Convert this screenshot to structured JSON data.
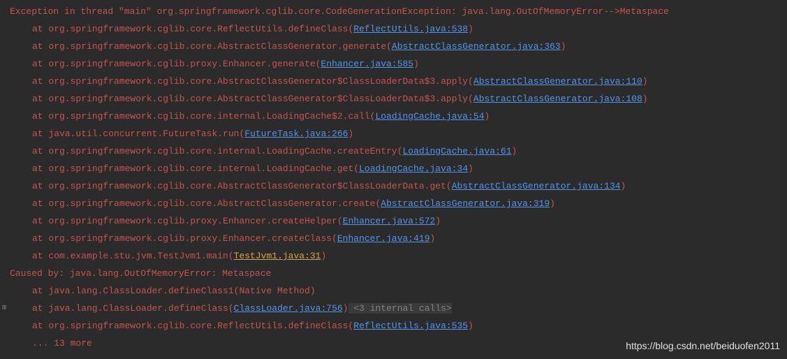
{
  "stacktrace": {
    "header": "Exception in thread \"main\" org.springframework.cglib.core.CodeGenerationException: java.lang.OutOfMemoryError-->Metaspace",
    "at_prefix": "at ",
    "frames": [
      {
        "method": "org.springframework.cglib.core.ReflectUtils.defineClass(",
        "link": "ReflectUtils.java:538",
        "suffix": ")"
      },
      {
        "method": "org.springframework.cglib.core.AbstractClassGenerator.generate(",
        "link": "AbstractClassGenerator.java:363",
        "suffix": ")"
      },
      {
        "method": "org.springframework.cglib.proxy.Enhancer.generate(",
        "link": "Enhancer.java:585",
        "suffix": ")"
      },
      {
        "method": "org.springframework.cglib.core.AbstractClassGenerator$ClassLoaderData$3.apply(",
        "link": "AbstractClassGenerator.java:110",
        "suffix": ")"
      },
      {
        "method": "org.springframework.cglib.core.AbstractClassGenerator$ClassLoaderData$3.apply(",
        "link": "AbstractClassGenerator.java:108",
        "suffix": ")"
      },
      {
        "method": "org.springframework.cglib.core.internal.LoadingCache$2.call(",
        "link": "LoadingCache.java:54",
        "suffix": ")"
      },
      {
        "method": "java.util.concurrent.FutureTask.run(",
        "link": "FutureTask.java:266",
        "suffix": ")"
      },
      {
        "method": "org.springframework.cglib.core.internal.LoadingCache.createEntry(",
        "link": "LoadingCache.java:61",
        "suffix": ")"
      },
      {
        "method": "org.springframework.cglib.core.internal.LoadingCache.get(",
        "link": "LoadingCache.java:34",
        "suffix": ")"
      },
      {
        "method": "org.springframework.cglib.core.AbstractClassGenerator$ClassLoaderData.get(",
        "link": "AbstractClassGenerator.java:134",
        "suffix": ")"
      },
      {
        "method": "org.springframework.cglib.core.AbstractClassGenerator.create(",
        "link": "AbstractClassGenerator.java:319",
        "suffix": ")"
      },
      {
        "method": "org.springframework.cglib.proxy.Enhancer.createHelper(",
        "link": "Enhancer.java:572",
        "suffix": ")"
      },
      {
        "method": "org.springframework.cglib.proxy.Enhancer.createClass(",
        "link": "Enhancer.java:419",
        "suffix": ")"
      },
      {
        "method": "com.example.stu.jvm.TestJvm1.main(",
        "link": "TestJvm1.java:31",
        "suffix": ")",
        "link_style": "yellow"
      }
    ],
    "caused_by": "Caused by: java.lang.OutOfMemoryError: Metaspace",
    "caused_frames": [
      {
        "method": "java.lang.ClassLoader.defineClass1(Native Method)",
        "link": "",
        "suffix": ""
      },
      {
        "method": "java.lang.ClassLoader.defineClass(",
        "link": "ClassLoader.java:756",
        "suffix": ")",
        "internal": " <3 internal calls>",
        "has_expand": true
      },
      {
        "method": "org.springframework.cglib.core.ReflectUtils.defineClass(",
        "link": "ReflectUtils.java:535",
        "suffix": ")"
      }
    ],
    "more": "... 13 more"
  },
  "watermark": "https://blog.csdn.net/beiduofen2011",
  "expand_icon": "⊞"
}
